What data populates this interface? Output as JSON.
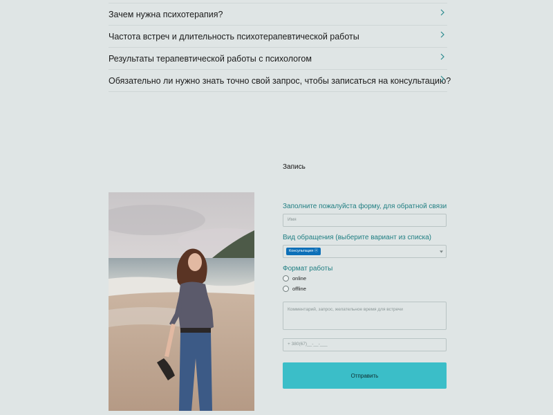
{
  "faq": {
    "items": [
      {
        "question": "Зачем нужна психотерапия?"
      },
      {
        "question": "Частота встреч и длительность психотерапевтической работы"
      },
      {
        "question": "Результаты терапевтической работы с психологом"
      },
      {
        "question": "Обязательно ли нужно знать точно свой запрос, чтобы записаться на консультацию?"
      }
    ]
  },
  "form": {
    "title": "Запись",
    "intro": "Заполните пожалуйста форму, для обратной связи",
    "name_placeholder": "Имя",
    "type_label": "Вид обращения (выберите вариант из списка)",
    "type_selected": "Консультация",
    "format_label": "Формат работы",
    "format_options": [
      "online",
      "offline"
    ],
    "comment_placeholder": "Комментарий, запрос, желательное время для встречи",
    "phone_placeholder": "+ 380(67)__-__-___",
    "submit_label": "Отправить"
  },
  "colors": {
    "background": "#dfe5e5",
    "accent_text": "#1f7e82",
    "button": "#3bbec8",
    "tag": "#0c6fb8"
  },
  "icons": {
    "faq_expand": "chevron-right-icon",
    "select_open": "chevron-down-icon",
    "tag_remove": "close-circle-icon"
  }
}
